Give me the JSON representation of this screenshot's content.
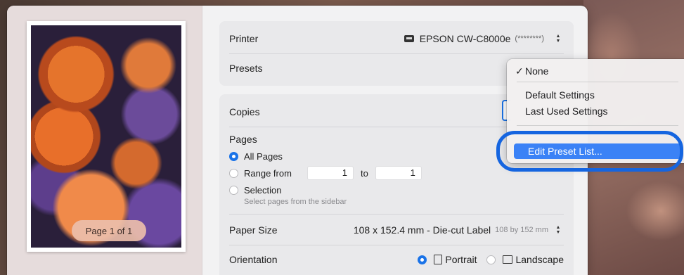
{
  "preview": {
    "page_indicator": "Page 1 of 1"
  },
  "printer": {
    "label": "Printer",
    "name": "EPSON CW-C8000e",
    "serial": "(********)"
  },
  "presets": {
    "label": "Presets"
  },
  "copies": {
    "label": "Copies"
  },
  "pages": {
    "label": "Pages",
    "options": [
      "All Pages",
      "Range from",
      "Selection"
    ],
    "selected": "All Pages",
    "range_from": "1",
    "range_to_label": "to",
    "range_to": "1",
    "selection_hint": "Select pages from the sidebar"
  },
  "paper_size": {
    "label": "Paper Size",
    "value": "108 x 152.4 mm - Die-cut Label",
    "detail": "108 by 152 mm"
  },
  "orientation": {
    "label": "Orientation",
    "options": [
      "Portrait",
      "Landscape"
    ],
    "selected": "Portrait"
  },
  "preset_menu": {
    "items": [
      "None",
      "Default Settings",
      "Last Used Settings",
      "Edit Preset List..."
    ],
    "checked": "None",
    "check_glyph": "✓",
    "highlighted": "Edit Preset List..."
  },
  "colors": {
    "accent": "#1a73e8",
    "callout_ring": "#1565e0",
    "menu_highlight": "#3b82f6"
  }
}
